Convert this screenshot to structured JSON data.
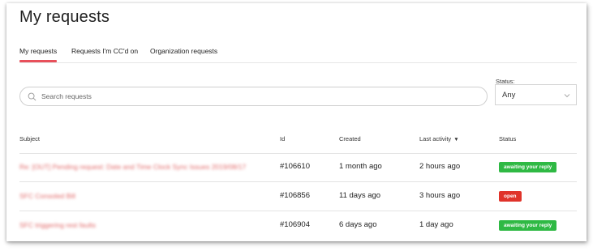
{
  "page": {
    "title": "My requests"
  },
  "tabs": [
    {
      "label": "My requests",
      "active": true
    },
    {
      "label": "Requests I'm CC'd on",
      "active": false
    },
    {
      "label": "Organization requests",
      "active": false
    }
  ],
  "search": {
    "placeholder": "Search requests",
    "value": ""
  },
  "filter": {
    "label": "Status:",
    "value": "Any"
  },
  "table": {
    "columns": {
      "subject": "Subject",
      "id": "Id",
      "created": "Created",
      "last_activity": "Last activity",
      "status": "Status"
    },
    "sort_indicator": "▼",
    "rows": [
      {
        "subject": "Re: [OUT] Pending request: Date and Time Clock Sync Issues 2019/08/17",
        "id": "#106610",
        "created": "1 month ago",
        "last_activity": "2 hours ago",
        "status": "awaiting your reply",
        "status_color": "#2fb944"
      },
      {
        "subject": "SFC Consoled Bill",
        "id": "#106856",
        "created": "11 days ago",
        "last_activity": "3 hours ago",
        "status": "open",
        "status_color": "#e0332a"
      },
      {
        "subject": "SFC triggering rest faults",
        "id": "#106904",
        "created": "6 days ago",
        "last_activity": "1 day ago",
        "status": "awaiting your reply",
        "status_color": "#2fb944"
      }
    ]
  },
  "colors": {
    "accent": "#e8505b",
    "awaiting": "#2fb944",
    "open": "#e0332a"
  }
}
